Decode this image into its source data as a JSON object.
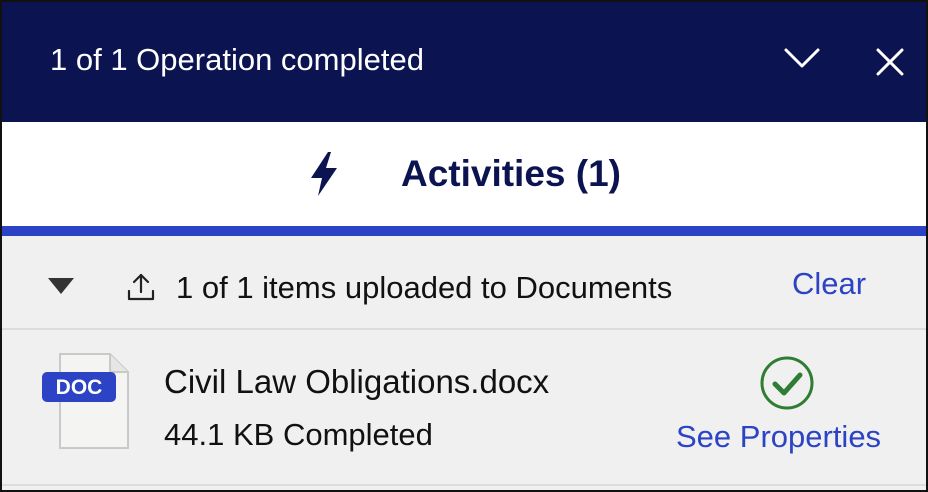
{
  "header": {
    "title": "1 of 1 Operation completed",
    "collapse_icon": "chevron-down-icon",
    "close_icon": "close-icon",
    "background_color": "#0b1450"
  },
  "tab": {
    "icon": "lightning-bolt-icon",
    "label": "Activities (1)",
    "accent_color": "#2b43c4"
  },
  "group": {
    "expand_icon": "caret-down-icon",
    "upload_icon": "upload-icon",
    "label": "1 of 1 items uploaded to Documents",
    "clear_label": "Clear"
  },
  "file": {
    "type_badge": "DOC",
    "name": "Civil Law Obligations.docx",
    "size": "44.1 KB",
    "status": "Completed",
    "status_icon": "check-circle-icon",
    "status_color": "#2f7d32",
    "properties_link": "See Properties"
  }
}
